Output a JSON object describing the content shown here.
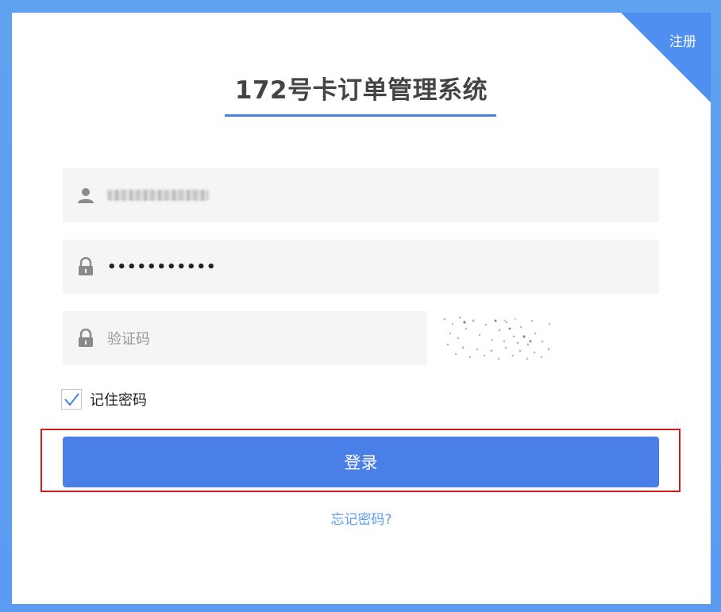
{
  "corner": {
    "register_label": "注册"
  },
  "header": {
    "title": "172号卡订单管理系统"
  },
  "form": {
    "username_value": "",
    "password_value": "•••••••••••",
    "captcha_placeholder": "验证码",
    "remember_label": "记住密码",
    "remember_checked": true,
    "login_label": "登录",
    "forgot_label": "忘记密码?"
  },
  "colors": {
    "accent": "#4a7fe8",
    "corner": "#4e8ff0",
    "link": "#5a9cf0",
    "highlight": "#d21b1b"
  },
  "icons": {
    "username": "user-icon",
    "password": "lock-icon",
    "captcha": "lock-icon",
    "remember": "check-icon"
  }
}
